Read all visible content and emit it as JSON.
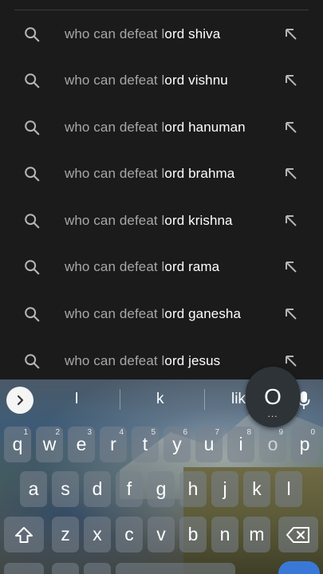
{
  "suggestions": {
    "typed_prefix": "who can defeat l",
    "items": [
      {
        "typed": "who can defeat l",
        "rest": "ord shiva"
      },
      {
        "typed": "who can defeat l",
        "rest": "ord vishnu"
      },
      {
        "typed": "who can defeat l",
        "rest": "ord hanuman"
      },
      {
        "typed": "who can defeat l",
        "rest": "ord brahma"
      },
      {
        "typed": "who can defeat l",
        "rest": "ord krishna"
      },
      {
        "typed": "who can defeat l",
        "rest": "ord rama"
      },
      {
        "typed": "who can defeat l",
        "rest": "ord ganesha"
      },
      {
        "typed": "who can defeat l",
        "rest": "ord jesus"
      }
    ],
    "leading_icon": "search-icon",
    "trailing_icon": "insert-arrow-icon"
  },
  "keyboard": {
    "toolbar": {
      "expand_icon": "chevron-right-icon",
      "suggestion_1": "l",
      "suggestion_2": "k",
      "suggestion_3": "lik",
      "mic_icon": "mic-icon"
    },
    "popup": {
      "letter": "O",
      "more": "..."
    },
    "row1": [
      {
        "label": "q",
        "hint": "1"
      },
      {
        "label": "w",
        "hint": "2"
      },
      {
        "label": "e",
        "hint": "3"
      },
      {
        "label": "r",
        "hint": "4"
      },
      {
        "label": "t",
        "hint": "5"
      },
      {
        "label": "y",
        "hint": "6"
      },
      {
        "label": "u",
        "hint": "7"
      },
      {
        "label": "i",
        "hint": "8"
      },
      {
        "label": "o",
        "hint": "9"
      },
      {
        "label": "p",
        "hint": "0"
      }
    ],
    "row2": [
      "a",
      "s",
      "d",
      "f",
      "g",
      "h",
      "j",
      "k",
      "l"
    ],
    "row3": [
      "z",
      "x",
      "c",
      "v",
      "b",
      "n",
      "m"
    ],
    "shift_icon": "shift-icon",
    "backspace_icon": "backspace-icon"
  }
}
